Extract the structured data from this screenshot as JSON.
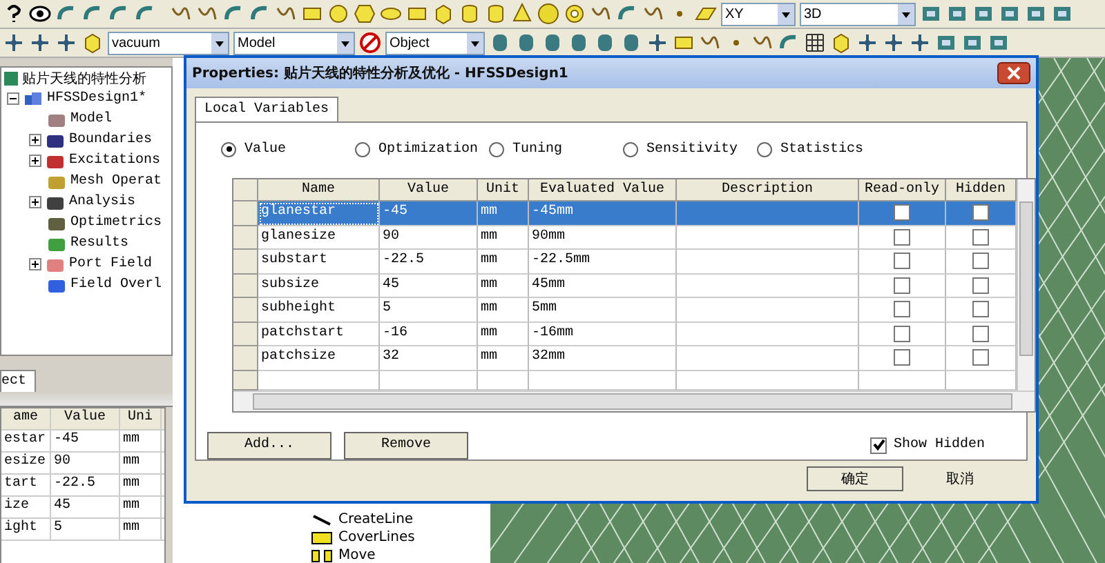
{
  "toolbar_row_1": {
    "plane_select": "XY",
    "view_select": "3D"
  },
  "toolbar_row_2": {
    "material_select": "vacuum",
    "mode_select": "Model",
    "selection_select": "Object"
  },
  "project_tree": {
    "root": "贴片天线的特性分析",
    "design": {
      "label": "HFSSDesign1*",
      "expanded": true,
      "children": [
        {
          "label": "Model",
          "kind": "model"
        },
        {
          "label": "Boundaries",
          "kind": "boundary",
          "expanded": false
        },
        {
          "label": "Excitations",
          "kind": "excitation",
          "expanded": false
        },
        {
          "label": "Mesh Operat",
          "kind": "mesh"
        },
        {
          "label": "Analysis",
          "kind": "analysis",
          "expanded": false
        },
        {
          "label": "Optimetrics",
          "kind": "optimetrics"
        },
        {
          "label": "Results",
          "kind": "results"
        },
        {
          "label": "Port Field",
          "kind": "port",
          "expanded": false
        },
        {
          "label": "Field Overl",
          "kind": "field"
        }
      ]
    }
  },
  "project_tab": "ect",
  "properties_panel": {
    "columns": [
      "ame",
      "Value",
      "Uni"
    ],
    "rows": [
      [
        "estar",
        "-45",
        "mm"
      ],
      [
        "esize",
        "90",
        "mm"
      ],
      [
        "tart",
        "-22.5",
        "mm"
      ],
      [
        "ize",
        "45",
        "mm"
      ],
      [
        "ight",
        "5",
        "mm"
      ]
    ]
  },
  "history_tree": [
    {
      "label": "CreateLine",
      "kind": "line"
    },
    {
      "label": "CoverLines",
      "kind": "cover"
    },
    {
      "label": "Move",
      "kind": "move"
    }
  ],
  "dialog": {
    "title": "Properties: 贴片天线的特性分析及优化 - HFSSDesign1",
    "tab": "Local Variables",
    "modes": [
      {
        "label": "Value",
        "selected": true
      },
      {
        "label": "Optimization",
        "selected": false
      },
      {
        "label": "Tuning",
        "selected": false
      },
      {
        "label": "Sensitivity",
        "selected": false
      },
      {
        "label": "Statistics",
        "selected": false
      }
    ],
    "columns": [
      "Name",
      "Value",
      "Unit",
      "Evaluated Value",
      "Description",
      "Read-only",
      "Hidden"
    ],
    "rows": [
      {
        "name": "glanestar",
        "value": "-45",
        "unit": "mm",
        "evaluated": "-45mm",
        "read_only": false,
        "hidden": false,
        "selected": true
      },
      {
        "name": "glanesize",
        "value": "90",
        "unit": "mm",
        "evaluated": "90mm",
        "read_only": false,
        "hidden": false,
        "selected": false
      },
      {
        "name": "substart",
        "value": "-22.5",
        "unit": "mm",
        "evaluated": "-22.5mm",
        "read_only": false,
        "hidden": false,
        "selected": false
      },
      {
        "name": "subsize",
        "value": "45",
        "unit": "mm",
        "evaluated": "45mm",
        "read_only": false,
        "hidden": false,
        "selected": false
      },
      {
        "name": "subheight",
        "value": "5",
        "unit": "mm",
        "evaluated": "5mm",
        "read_only": false,
        "hidden": false,
        "selected": false
      },
      {
        "name": "patchstart",
        "value": "-16",
        "unit": "mm",
        "evaluated": "-16mm",
        "read_only": false,
        "hidden": false,
        "selected": false
      },
      {
        "name": "patchsize",
        "value": "32",
        "unit": "mm",
        "evaluated": "32mm",
        "read_only": false,
        "hidden": false,
        "selected": false
      }
    ],
    "add_button": "Add...",
    "remove_button": "Remove",
    "show_hidden": {
      "label": "Show Hidden",
      "checked": true
    },
    "ok_button": "确定",
    "cancel_button": "取消"
  }
}
